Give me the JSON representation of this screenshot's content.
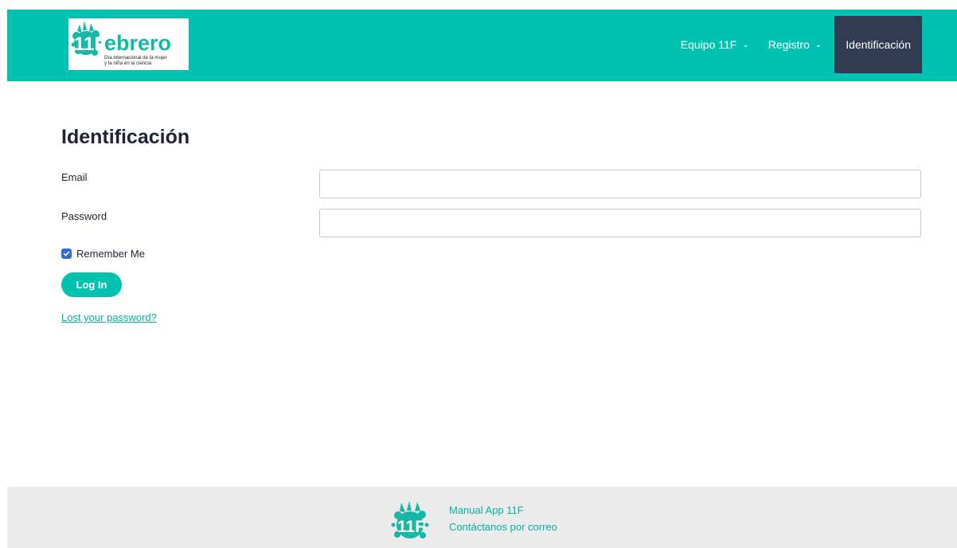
{
  "header": {
    "logo": {
      "main_text": "11Febrero",
      "tagline_line1": "Día internacional de la mujer",
      "tagline_line2": "y la niña en la ciencia"
    },
    "nav": [
      {
        "label": "Equipo 11F",
        "has_dropdown": true,
        "active": false
      },
      {
        "label": "Registro",
        "has_dropdown": true,
        "active": false
      },
      {
        "label": "Identificación",
        "has_dropdown": false,
        "active": true
      }
    ]
  },
  "main": {
    "title": "Identificación",
    "email": {
      "label": "Email",
      "value": "",
      "placeholder": ""
    },
    "password": {
      "label": "Password",
      "value": "",
      "placeholder": ""
    },
    "remember": {
      "label": "Remember Me",
      "checked": true
    },
    "login_label": "Log In",
    "lost_password_label": "Lost your password?"
  },
  "footer": {
    "logo_text": "11F",
    "links": [
      "Manual App 11F",
      "Contáctanos por correo"
    ]
  },
  "colors": {
    "brand": "#00c2b0",
    "nav_active": "#303c52",
    "footer_bg": "#ebebeb",
    "link": "#00b3a3",
    "checkbox": "#2f6ddc"
  }
}
